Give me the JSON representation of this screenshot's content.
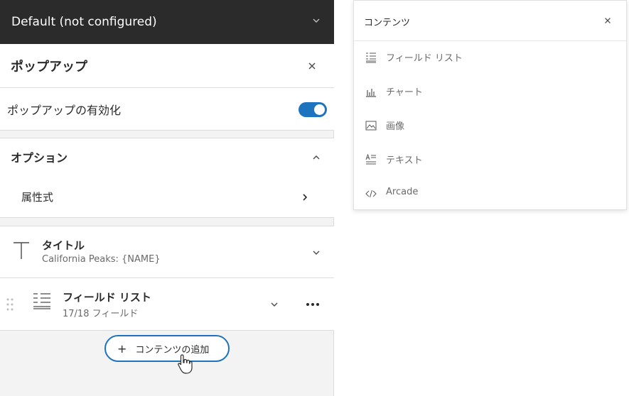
{
  "topbar": {
    "title": "Default (not configured)"
  },
  "popup": {
    "title": "ポップアップ"
  },
  "enable": {
    "label": "ポップアップの有効化",
    "enabled": true
  },
  "options": {
    "title": "オプション",
    "attribute_expressions": "属性式"
  },
  "content_items": [
    {
      "title": "タイトル",
      "subtitle": "California Peaks: {NAME}"
    },
    {
      "title": "フィールド リスト",
      "subtitle": "17/18 フィールド"
    }
  ],
  "add_content": {
    "label": "コンテンツの追加"
  },
  "content_menu": {
    "title": "コンテンツ",
    "items": [
      {
        "label": "フィールド リスト",
        "icon": "field-list-icon"
      },
      {
        "label": "チャート",
        "icon": "chart-icon"
      },
      {
        "label": "画像",
        "icon": "image-icon"
      },
      {
        "label": "テキスト",
        "icon": "text-icon"
      },
      {
        "label": "Arcade",
        "icon": "code-icon"
      }
    ]
  },
  "colors": {
    "accent": "#1d73bd",
    "topbar_bg": "#2b2b2b"
  }
}
